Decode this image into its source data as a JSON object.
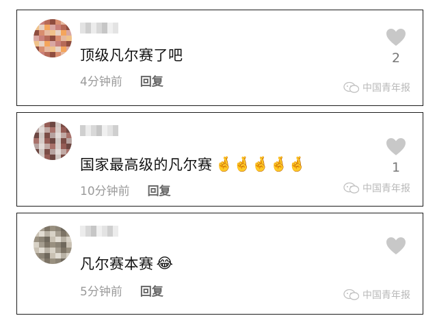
{
  "comments": [
    {
      "text": "顶级凡尔赛了吧",
      "emojis": [],
      "time": "4分钟前",
      "reply_label": "回复",
      "likes": "2",
      "watermark": "中国青年报",
      "avatar_colors": [
        "#d9a7a2",
        "#e6b9a0",
        "#c9807a",
        "#f0c28a",
        "#b66a58",
        "#e7d2c4",
        "#8f4d3f",
        "#f4a55c",
        "#d88d6f"
      ]
    },
    {
      "text": "国家最高级的凡尔赛",
      "emojis": [
        "🤞",
        "🤞",
        "🤞",
        "🤞",
        "🤞"
      ],
      "time": "10分钟前",
      "reply_label": "回复",
      "likes": "1",
      "watermark": "中国青年报",
      "avatar_colors": [
        "#cfc6c2",
        "#a8716a",
        "#7b4c45",
        "#d6cbc7",
        "#b7a3a0",
        "#955c55",
        "#e2dad7",
        "#6d4742",
        "#c1a9a4"
      ]
    },
    {
      "text": "凡尔赛本赛",
      "emojis": [
        "😂"
      ],
      "time": "5分钟前",
      "reply_label": "回复",
      "likes": "",
      "watermark": "中国青年报",
      "avatar_colors": [
        "#b9b2a5",
        "#8c8476",
        "#d8d2c6",
        "#6f685c",
        "#a59d8f",
        "#c9c1b3",
        "#7d7466",
        "#e2ddd3",
        "#999080"
      ]
    }
  ],
  "colors": {
    "like_icon": "#c8c8c8",
    "meta_text": "#9a9a9a",
    "border": "#1a1a1a"
  },
  "icons": {
    "like": "heart-icon",
    "watermark": "wechat-icon"
  }
}
